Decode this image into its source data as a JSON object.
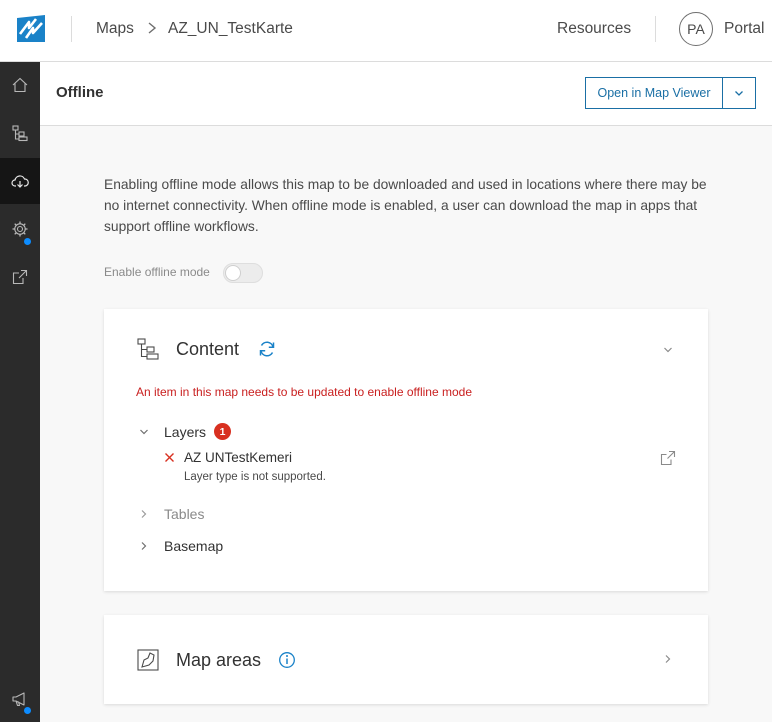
{
  "header": {
    "breadcrumb_root": "Maps",
    "breadcrumb_current": "AZ_UN_TestKarte",
    "resources_label": "Resources",
    "avatar_initials": "PA",
    "portal_label": "Portal"
  },
  "page": {
    "title": "Offline",
    "open_button_label": "Open in Map Viewer",
    "description": "Enabling offline mode allows this map to be downloaded and used in locations where there may be no internet connectivity. When offline mode is enabled, a user can download the map in apps that support offline workflows.",
    "toggle_label": "Enable offline mode",
    "toggle_on": false
  },
  "content_card": {
    "title": "Content",
    "warning": "An item in this map needs to be updated to enable offline mode",
    "layers_label": "Layers",
    "layers_badge": "1",
    "layer_name": "AZ UNTestKemeri",
    "layer_status": "Layer type is not supported.",
    "tables_label": "Tables",
    "basemap_label": "Basemap"
  },
  "areas_card": {
    "title": "Map areas"
  },
  "colors": {
    "accent": "#1a6fa5",
    "error": "#c92020",
    "badge": "#d83020",
    "nav_bg": "#2b2b2b",
    "notification_dot": "#0d8cff"
  },
  "icons": {
    "nav": [
      "home-icon",
      "content-tree-icon",
      "offline-cloud-icon",
      "settings-gear-icon",
      "share-export-icon",
      "feedback-megaphone-icon"
    ]
  }
}
